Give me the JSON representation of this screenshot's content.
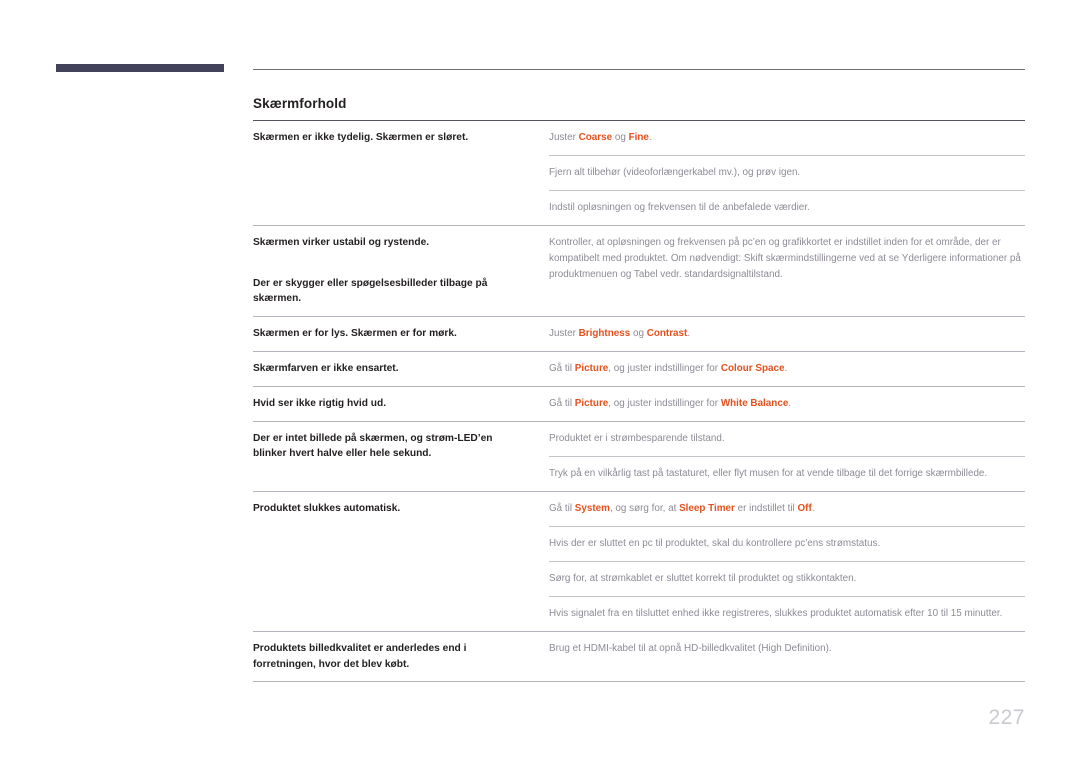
{
  "page": {
    "section_title": "Skærmforhold",
    "folio": "227",
    "accent_color": "#e4511e",
    "corner_mark_color": "#42425a",
    "body_text_color": "#8e8a96",
    "heading_text_color": "#231f20"
  },
  "table": {
    "rows": [
      {
        "symptom": "Skærmen er ikke tydelig. Skærmen er sløret.",
        "remedies": [
          [
            {
              "t": "Juster ",
              "hl": false
            },
            {
              "t": "Coarse",
              "hl": true
            },
            {
              "t": " og ",
              "hl": false
            },
            {
              "t": "Fine",
              "hl": true
            },
            {
              "t": ".",
              "hl": false
            }
          ],
          [
            {
              "t": "Fjern alt tilbehør (videoforlængerkabel mv.), og prøv igen.",
              "hl": false
            }
          ],
          [
            {
              "t": "Indstil opløsningen og frekvensen til de anbefalede værdier.",
              "hl": false
            }
          ]
        ]
      },
      {
        "symptom": "Skærmen virker ustabil og rystende.",
        "symptom2": "Der er skygger eller spøgelsesbilleder tilbage på skærmen.",
        "remedies": [
          [
            {
              "t": "Kontroller, at opløsningen og frekvensen på pc’en og grafikkortet er indstillet inden for et område, der er kompatibelt med produktet. Om nødvendigt: Skift skærmindstillingerne ved at se Yderligere informationer på produktmenuen og Tabel vedr. standardsignaltilstand.",
              "hl": false
            }
          ]
        ]
      },
      {
        "symptom": "Skærmen er for lys. Skærmen er for mørk.",
        "remedies": [
          [
            {
              "t": "Juster ",
              "hl": false
            },
            {
              "t": "Brightness",
              "hl": true
            },
            {
              "t": " og ",
              "hl": false
            },
            {
              "t": "Contrast",
              "hl": true
            },
            {
              "t": ".",
              "hl": false
            }
          ]
        ]
      },
      {
        "symptom": "Skærmfarven er ikke ensartet.",
        "remedies": [
          [
            {
              "t": "Gå til ",
              "hl": false
            },
            {
              "t": "Picture",
              "hl": true
            },
            {
              "t": ", og juster indstillinger for ",
              "hl": false
            },
            {
              "t": "Colour Space",
              "hl": true
            },
            {
              "t": ".",
              "hl": false
            }
          ]
        ]
      },
      {
        "symptom": "Hvid ser ikke rigtig hvid ud.",
        "remedies": [
          [
            {
              "t": "Gå til ",
              "hl": false
            },
            {
              "t": "Picture",
              "hl": true
            },
            {
              "t": ", og juster indstillinger for ",
              "hl": false
            },
            {
              "t": "White Balance",
              "hl": true
            },
            {
              "t": ".",
              "hl": false
            }
          ]
        ]
      },
      {
        "symptom": "Der er intet billede på skærmen, og strøm-LED’en blinker hvert halve eller hele sekund.",
        "remedies": [
          [
            {
              "t": "Produktet er i strømbesparende tilstand.",
              "hl": false
            }
          ],
          [
            {
              "t": "Tryk på en vilkårlig tast på tastaturet, eller flyt musen for at vende tilbage til det forrige skærmbillede.",
              "hl": false
            }
          ]
        ]
      },
      {
        "symptom": "Produktet slukkes automatisk.",
        "remedies": [
          [
            {
              "t": "Gå til ",
              "hl": false
            },
            {
              "t": "System",
              "hl": true
            },
            {
              "t": ", og sørg for, at ",
              "hl": false
            },
            {
              "t": "Sleep Timer",
              "hl": true
            },
            {
              "t": " er indstillet til ",
              "hl": false
            },
            {
              "t": "Off",
              "hl": true
            },
            {
              "t": ".",
              "hl": false
            }
          ],
          [
            {
              "t": "Hvis der er sluttet en pc til produktet, skal du kontrollere pc'ens strømstatus.",
              "hl": false
            }
          ],
          [
            {
              "t": "Sørg for, at strømkablet er sluttet korrekt til produktet og stikkontakten.",
              "hl": false
            }
          ],
          [
            {
              "t": "Hvis signalet fra en tilsluttet enhed ikke registreres, slukkes produktet automatisk efter 10 til 15 minutter.",
              "hl": false
            }
          ]
        ]
      },
      {
        "symptom": "Produktets billedkvalitet er anderledes end i forretningen, hvor det blev købt.",
        "remedies": [
          [
            {
              "t": "Brug et HDMI-kabel til at opnå HD-billedkvalitet (High Definition).",
              "hl": false
            }
          ]
        ]
      }
    ]
  }
}
